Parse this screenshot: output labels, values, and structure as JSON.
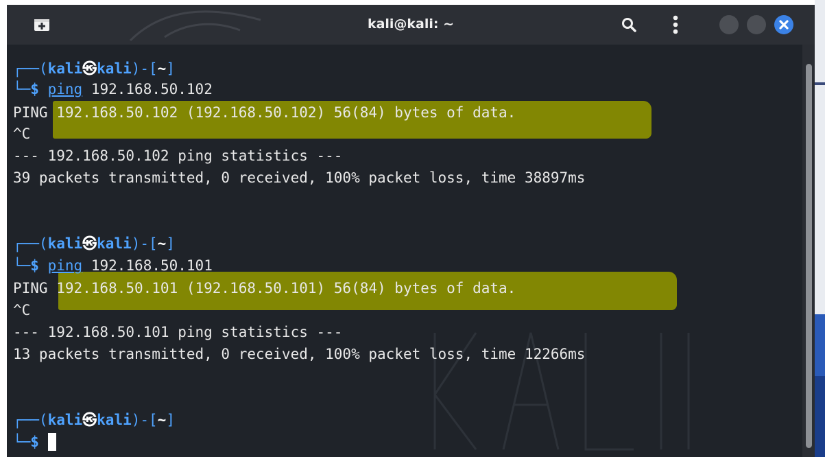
{
  "window": {
    "title": "kali@kali: ~"
  },
  "icons": {
    "new_tab": "new-tab-icon",
    "search": "search-icon",
    "menu": "kebab-menu-icon",
    "minimize": "minimize-icon",
    "maximize": "maximize-icon",
    "close": "close-icon"
  },
  "colors": {
    "terminal_bg": "#1f2329",
    "prompt_blue": "#4fa3ff",
    "highlight": "#8a8f00",
    "close_button": "#3b82e6"
  },
  "prompt": {
    "open": "┌──(",
    "user": "kali",
    "at": "㉿",
    "host": "kali",
    "path_open": ")-[",
    "path": "~",
    "path_close": "]",
    "second_line": "└─",
    "dollar": "$"
  },
  "sessions": [
    {
      "command": "ping",
      "argument": "192.168.50.102",
      "output": [
        "PING 192.168.50.102 (192.168.50.102) 56(84) bytes of data.",
        "^C",
        "--- 192.168.50.102 ping statistics ---",
        "39 packets transmitted, 0 received, 100% packet loss, time 38897ms"
      ]
    },
    {
      "command": "ping",
      "argument": "192.168.50.101",
      "output": [
        "PING 192.168.50.101 (192.168.50.101) 56(84) bytes of data.",
        "^C",
        "--- 192.168.50.101 ping statistics ---",
        "13 packets transmitted, 0 received, 100% packet loss, time 12266ms"
      ]
    }
  ]
}
